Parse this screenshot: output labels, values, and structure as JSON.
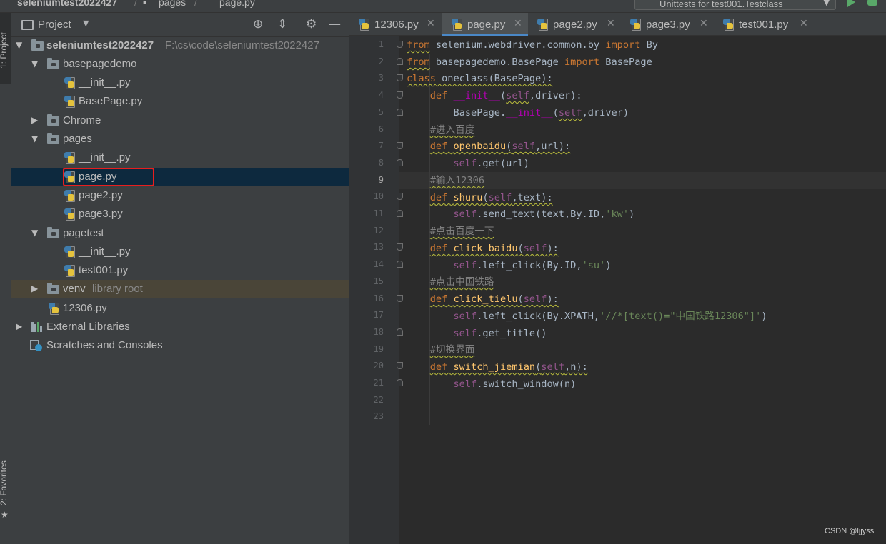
{
  "breadcrumb": {
    "project": "seleniumtest2022427",
    "folder": "pages",
    "file": "page.py"
  },
  "run_config": {
    "label": "Unittests for test001.Testclass"
  },
  "tool_stripe": {
    "project_label": "1: Project",
    "favorites_label": "2: Favorites"
  },
  "project_panel": {
    "title": "Project",
    "tree": {
      "root_name": "seleniumtest2022427",
      "root_path": "F:\\cs\\code\\seleniumtest2022427",
      "basepagedemo": "basepagedemo",
      "bp_init": "__init__.py",
      "bp_basepage": "BasePage.py",
      "chrome": "Chrome",
      "pages": "pages",
      "pages_init": "__init__.py",
      "pages_page": "page.py",
      "pages_page2": "page2.py",
      "pages_page3": "page3.py",
      "pagetest": "pagetest",
      "pt_init": "__init__.py",
      "pt_test001": "test001.py",
      "venv": "venv",
      "venv_note": "library root",
      "file_12306": "12306.py",
      "external_libraries": "External Libraries",
      "scratches": "Scratches and Consoles"
    }
  },
  "editor": {
    "tabs": [
      "12306.py",
      "page.py",
      "page2.py",
      "page3.py",
      "test001.py"
    ],
    "active_tab": "page.py",
    "current_line": 9,
    "code": {
      "l1_from": "from",
      "l1_mod": " selenium.webdriver.common.by ",
      "l1_import": "import",
      "l1_name": " By",
      "l2_from": "from",
      "l2_mod": " basepagedemo.BasePage ",
      "l2_import": "import",
      "l2_name": " BasePage",
      "l3_class": "class",
      "l3_rest": " oneclass(BasePage):",
      "l4_def": "def ",
      "l4_init": "__init__",
      "l4_open": "(",
      "l4_self": "self",
      "l4_rest": ",driver):",
      "l5_a": "BasePage.",
      "l5_init": "__init__",
      "l5_open": "(",
      "l5_self": "self",
      "l5_rest": ",driver)",
      "l6": "#进入百度",
      "l7_def": "def ",
      "l7_fn": "openbaidu",
      "l7_open": "(",
      "l7_self": "self",
      "l7_rest": ",url):",
      "l8_self": "self",
      "l8_rest": ".get(url)",
      "l9": "#输入12306",
      "l10_def": "def ",
      "l10_fn": "shuru",
      "l10_open": "(",
      "l10_self": "self",
      "l10_rest": ",text):",
      "l11_self": "self",
      "l11_rest": ".send_text(text,By.ID,",
      "l11_str": "'kw'",
      "l11_close": ")",
      "l12": "#点击百度一下",
      "l13_def": "def ",
      "l13_fn": "click_baidu",
      "l13_open": "(",
      "l13_self": "self",
      "l13_rest": "):",
      "l14_self": "self",
      "l14_rest": ".left_click(By.ID,",
      "l14_str": "'su'",
      "l14_close": ")",
      "l15": "#点击中国铁路",
      "l16_def": "def ",
      "l16_fn": "click_tielu",
      "l16_open": "(",
      "l16_self": "self",
      "l16_rest": "):",
      "l17_self": "self",
      "l17_rest": ".left_click(By.XPATH,",
      "l17_str": "'//*[text()=\"中国铁路12306\"]'",
      "l17_close": ")",
      "l18_self": "self",
      "l18_rest": ".get_title()",
      "l19": "#切换界面",
      "l20_def": "def ",
      "l20_fn": "switch_jiemian",
      "l20_open": "(",
      "l20_self": "self",
      "l20_rest": ",n):",
      "l21_self": "self",
      "l21_rest": ".switch_window(n)"
    }
  },
  "watermark": "CSDN @ljjyss",
  "colors": {
    "keyword": "#cc7832",
    "self": "#94558d",
    "comment": "#808080",
    "string": "#6a8759",
    "selection": "#0d293e",
    "highlight_box": "#e81e1e"
  },
  "icons": {
    "project_view": "project-window-icon",
    "locate": "crosshair-icon",
    "collapse": "collapse-all-icon",
    "settings": "gear-icon",
    "hide": "minimize-icon",
    "run": "run-icon",
    "debug": "debug-icon"
  }
}
